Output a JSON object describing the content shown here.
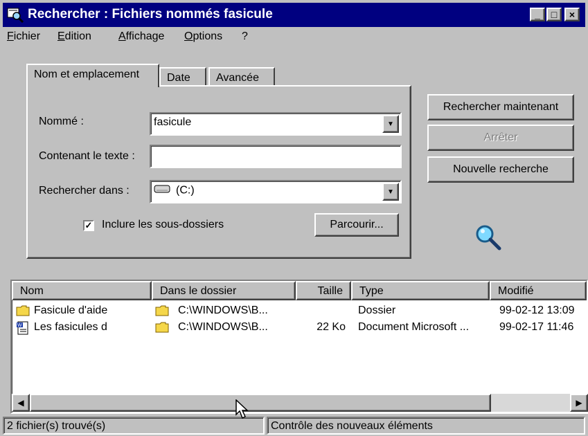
{
  "window": {
    "title": "Rechercher : Fichiers nommés fasicule",
    "controls": {
      "minimize": "_",
      "maximize": "□",
      "close": "×"
    }
  },
  "menu": [
    "Fichier",
    "Edition",
    "Affichage",
    "Options",
    "?"
  ],
  "tabs": [
    "Nom et emplacement",
    "Date",
    "Avancée"
  ],
  "form": {
    "named_label": "Nommé :",
    "named_value": "fasicule",
    "contains_label": "Contenant le texte :",
    "contains_value": "",
    "lookin_label": "Rechercher dans :",
    "lookin_value": "(C:)",
    "include_subfolders_label": "Inclure les sous-dossiers",
    "include_subfolders_checked": true,
    "browse_label": "Parcourir..."
  },
  "actions": {
    "search_now": "Rechercher maintenant",
    "stop": "Arrêter",
    "new_search": "Nouvelle recherche"
  },
  "results": {
    "columns": [
      "Nom",
      "Dans le dossier",
      "Taille",
      "Type",
      "Modifié"
    ],
    "rows": [
      {
        "name": "Fasicule d'aide",
        "folder": "C:\\WINDOWS\\B...",
        "size": "",
        "type": "Dossier",
        "modified": "99-02-12 13:09",
        "icon": "folder-icon"
      },
      {
        "name": "Les fasicules d",
        "folder": "C:\\WINDOWS\\B...",
        "size": "22 Ko",
        "type": "Document Microsoft ...",
        "modified": "99-02-17 11:46",
        "icon": "word-document-icon"
      }
    ]
  },
  "status": {
    "found": "2 fichier(s) trouvé(s)",
    "monitoring": "Contrôle des nouveaux éléments"
  },
  "colors": {
    "titlebar": "#000080",
    "face": "#c0c0c0",
    "folder": "#f5d74a"
  }
}
